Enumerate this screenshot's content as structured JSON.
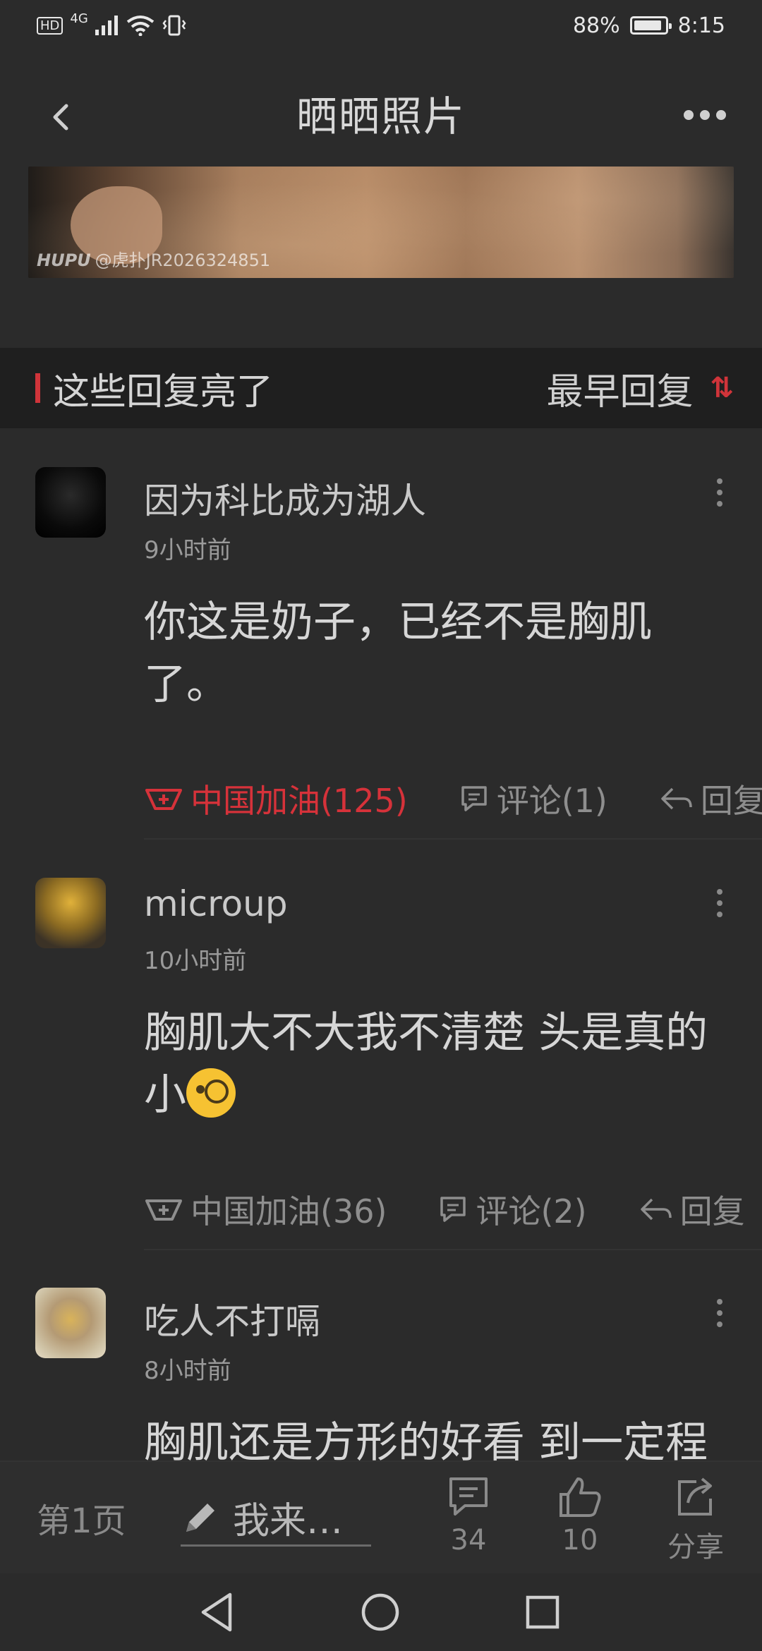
{
  "status_bar": {
    "network": "4G",
    "battery": "88%",
    "time": "8:15"
  },
  "header": {
    "title": "晒晒照片"
  },
  "banner": {
    "watermark_brand": "HUPU",
    "watermark_user": "@虎扑JR2026324851"
  },
  "section": {
    "title": "这些回复亮了",
    "sort_label": "最早回复",
    "sort_icon": "⇅"
  },
  "comments": [
    {
      "username": "因为科比成为湖人",
      "time": "9小时前",
      "text": "你这是奶子，已经不是胸肌了。",
      "cheer": "中国加油(125)",
      "comment": "评论(1)",
      "reply": "回复"
    },
    {
      "username": "microup",
      "time": "10小时前",
      "text": "胸肌大不大我不清楚 头是真的小",
      "cheer": "中国加油(36)",
      "comment": "评论(2)",
      "reply": "回复"
    },
    {
      "username": "吃人不打嗝",
      "time": "8小时前",
      "text": "胸肌还是方形的好看 到一定程"
    }
  ],
  "bottom_bar": {
    "page_label": "第1页",
    "input_placeholder": "我来…",
    "comments_count": "34",
    "likes_count": "10",
    "share_label": "分享"
  },
  "colors": {
    "accent_red": "#d6323a",
    "background": "#2b2b2b"
  }
}
